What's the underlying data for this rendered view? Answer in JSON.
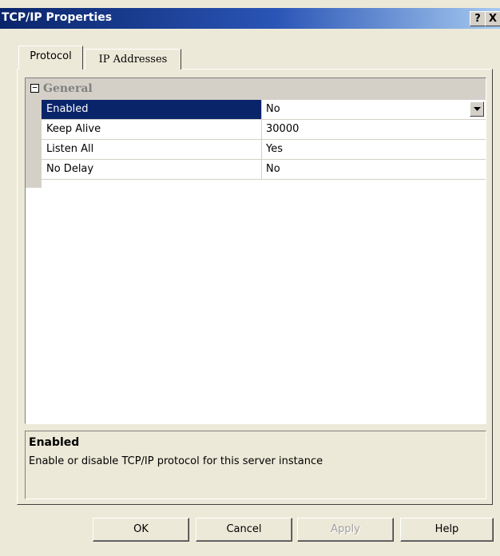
{
  "window": {
    "title": "TCP/IP Properties",
    "help_glyph": "?",
    "close_glyph": "X"
  },
  "tabs": [
    {
      "label": "Protocol",
      "active": true
    },
    {
      "label": "IP Addresses",
      "active": false
    }
  ],
  "grid": {
    "category": {
      "label": "General",
      "toggle_glyph": "⊟",
      "expanded": true
    },
    "properties": [
      {
        "name": "Enabled",
        "value": "No",
        "selected": true
      },
      {
        "name": "Keep Alive",
        "value": "30000",
        "selected": false
      },
      {
        "name": "Listen All",
        "value": "Yes",
        "selected": false
      },
      {
        "name": "No Delay",
        "value": "No",
        "selected": false
      }
    ]
  },
  "description": {
    "title": "Enabled",
    "text": "Enable or disable TCP/IP protocol for this server instance"
  },
  "buttons": {
    "ok": "OK",
    "cancel": "Cancel",
    "apply": "Apply",
    "help": "Help"
  },
  "colors": {
    "selection": "#0a246a",
    "face": "#ece9d8",
    "disabled_text": "#a0a0a0"
  },
  "icons": {
    "help": "help-icon",
    "close": "close-icon",
    "collapse": "collapse-icon",
    "dropdown": "chevron-down-icon"
  }
}
